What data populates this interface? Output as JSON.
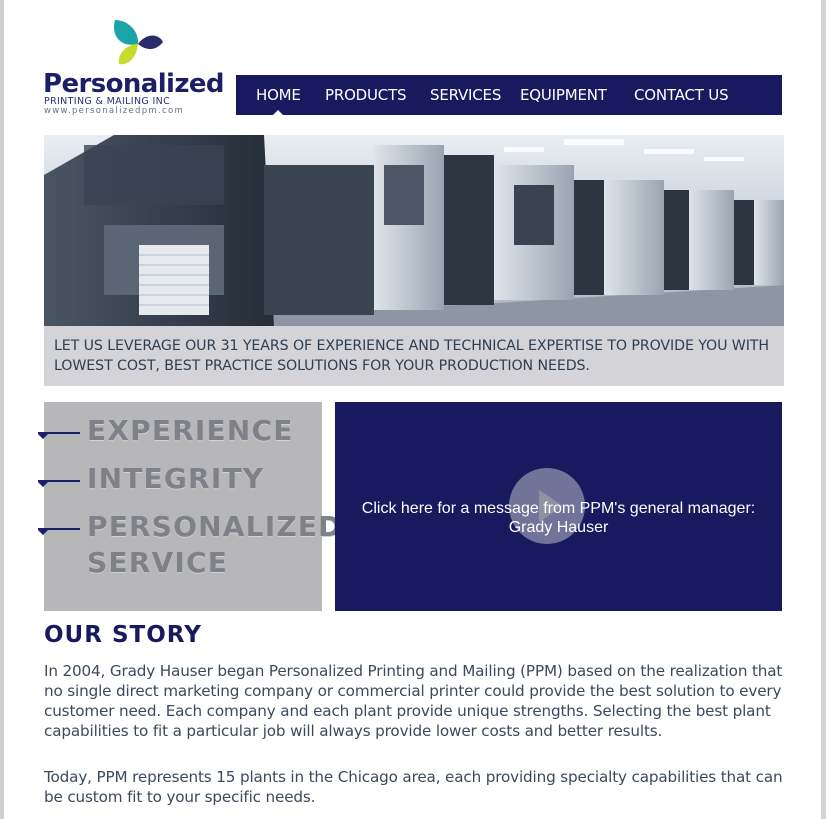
{
  "brand": {
    "name": "Personalized",
    "subtitle": "PRINTING & MAILING INC",
    "url": "www.personalizedpm.com"
  },
  "nav": {
    "items": [
      {
        "label": "HOME",
        "active": true
      },
      {
        "label": "PRODUCTS",
        "active": false
      },
      {
        "label": "SERVICES",
        "active": false
      },
      {
        "label": "EQUIPMENT",
        "active": false
      },
      {
        "label": "CONTACT US",
        "active": false
      }
    ]
  },
  "hero": {
    "caption": "LET US LEVERAGE OUR 31 YEARS OF EXPERIENCE AND TECHNICAL EXPERTISE TO PROVIDE YOU WITH LOWEST COST, BEST PRACTICE SOLUTIONS FOR YOUR PRODUCTION NEEDS."
  },
  "values": [
    {
      "word": "EXPERIENCE"
    },
    {
      "word": "INTEGRITY"
    },
    {
      "word_line1": "PERSONALIZED",
      "word_line2": "SERVICE"
    }
  ],
  "video": {
    "line1": "Click here for a message from PPM's general manager:",
    "line2": "Grady Hauser"
  },
  "story": {
    "title": "OUR STORY",
    "paragraph1": "In 2004, Grady Hauser began Personalized Printing and Mailing (PPM) based on the realization that no single direct marketing company or commercial printer could provide the best solution to every customer need. Each company and each plant provide unique strengths. Selecting the best plant capabilities to fit a particular job will always provide lower costs and better results.",
    "paragraph2": "Today, PPM represents 15 plants in the Chicago area, each providing specialty capabilities that can be custom fit to your specific needs."
  },
  "colors": {
    "navy": "#18195f",
    "caption_bg": "#d3d3d8",
    "values_bg": "#b7b7b9",
    "logo_teal": "#1aa4a6",
    "logo_lime": "#c6dc2c",
    "logo_navy": "#2a2c6b"
  }
}
